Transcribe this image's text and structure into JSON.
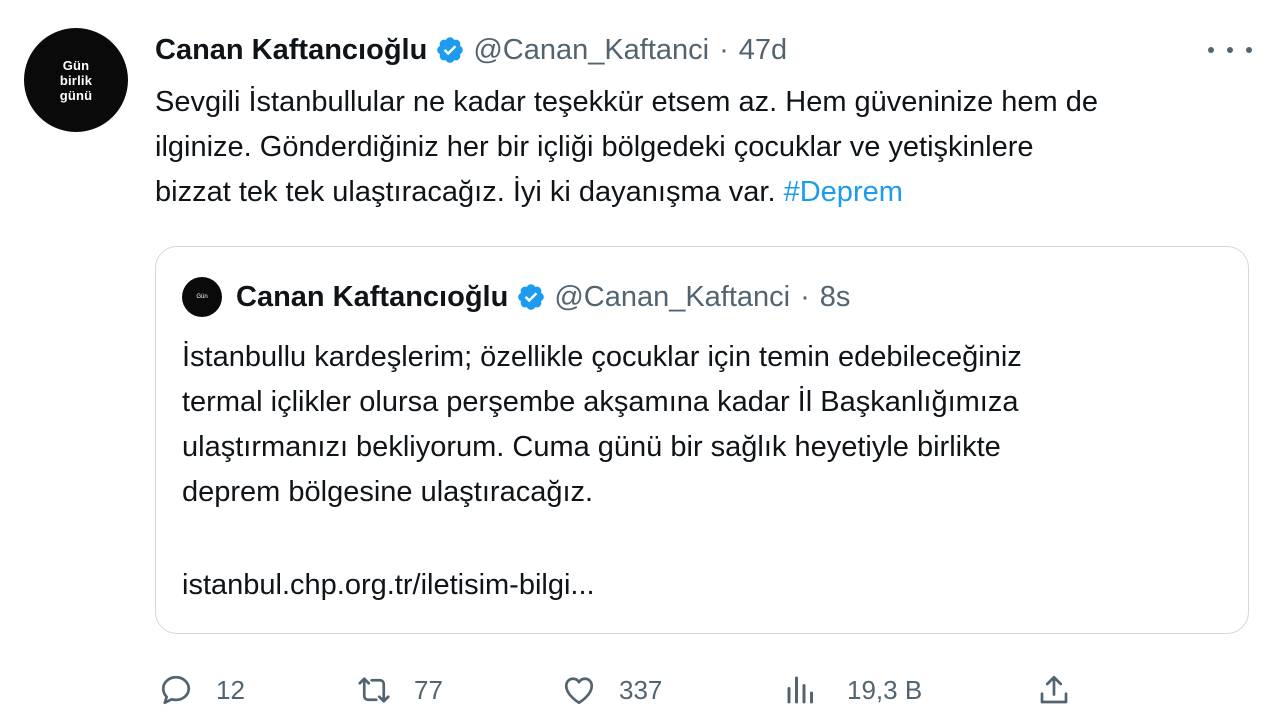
{
  "author": {
    "avatar_text": [
      "Gün",
      "birlik",
      "günü"
    ],
    "display_name": "Canan Kaftancıoğlu",
    "handle": "@Canan_Kaftanci",
    "separator": "·",
    "time": "47d"
  },
  "tweet": {
    "lines": [
      "Sevgili İstanbullular ne kadar teşekkür etsem az. Hem güveninize hem de",
      "ilginize. Gönderdiğiniz her bir içliği bölgedeki çocuklar ve yetişkinlere",
      "bizzat tek tek ulaştıracağız. İyi ki dayanışma var. "
    ],
    "hashtag": "#Deprem"
  },
  "quoted": {
    "avatar_text": [
      "Gün",
      "birlik",
      "günü"
    ],
    "display_name": "Canan Kaftancıoğlu",
    "handle": "@Canan_Kaftanci",
    "separator": "·",
    "time": "8s",
    "lines": [
      "İstanbullu kardeşlerim; özellikle çocuklar için temin edebileceğiniz",
      "termal içlikler olursa perşembe akşamına kadar İl Başkanlığımıza",
      "ulaştırmanızı bekliyorum. Cuma günü bir sağlık heyetiyle birlikte",
      "deprem bölgesine ulaştıracağız."
    ],
    "link": "istanbul.chp.org.tr/iletisim-bilgi..."
  },
  "actions": {
    "replies": "12",
    "retweets": "77",
    "likes": "337",
    "views": "19,3 B"
  },
  "colors": {
    "accent": "#1d9bf0",
    "muted": "#536471",
    "text": "#0f1419",
    "border": "#cfd9de"
  },
  "icons": {
    "verified": "verified-badge-icon",
    "more": "more-dots-icon",
    "reply": "reply-icon",
    "retweet": "retweet-icon",
    "like": "heart-icon",
    "views": "views-chart-icon",
    "share": "share-icon"
  }
}
